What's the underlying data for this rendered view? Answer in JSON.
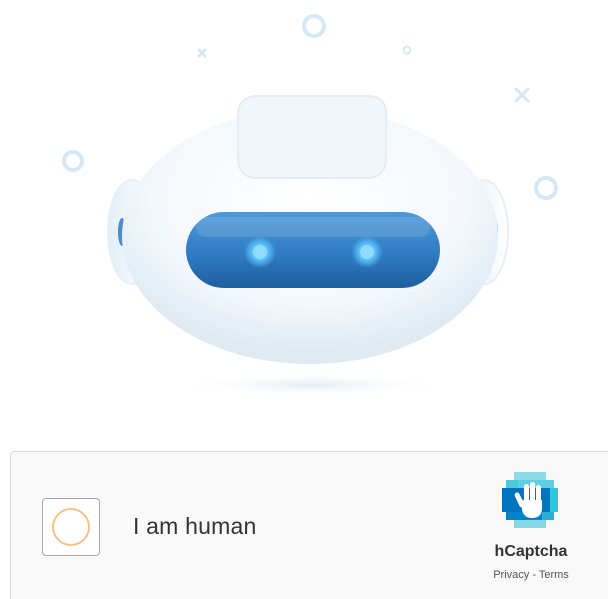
{
  "checkbox": {
    "label": "I am human",
    "checked": false,
    "state": "loading"
  },
  "branding": {
    "name": "hCaptcha",
    "privacy_label": "Privacy",
    "separator": " - ",
    "terms_label": "Terms"
  },
  "colors": {
    "visor": "#2f7cc4",
    "eyes": "#5ec6ff",
    "spinner": "#f5c189",
    "deco_shapes": "#d4e8f5",
    "logo_blue": "#0074bf",
    "logo_teal": "#37c3d9"
  },
  "icons": {
    "robot": "robot-face-illustration",
    "logo": "hcaptcha-hand-logo"
  }
}
